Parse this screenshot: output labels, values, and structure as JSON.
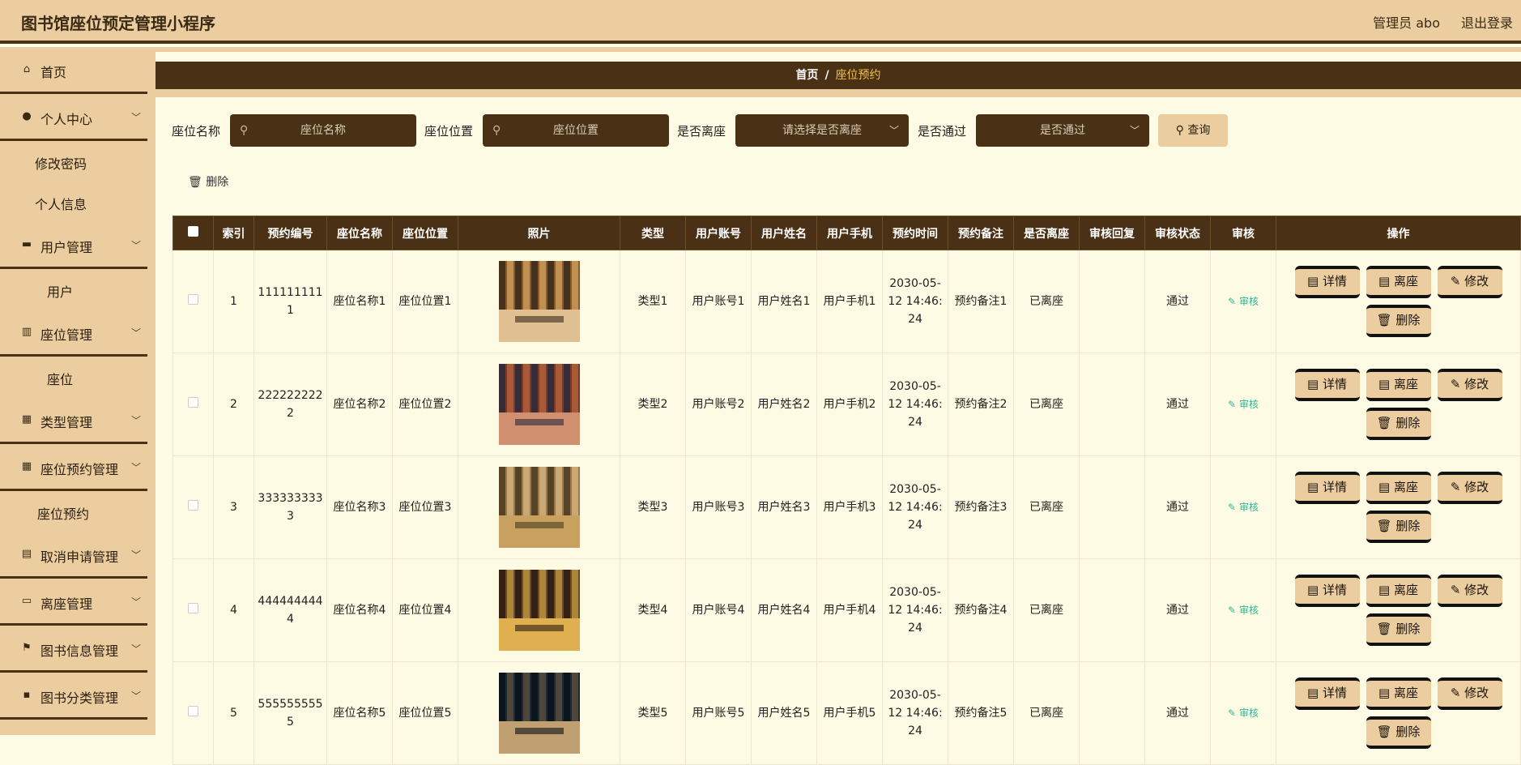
{
  "app": {
    "title": "图书馆座位预定管理小程序",
    "user": "管理员 abo",
    "logout": "退出登录"
  },
  "sidebar": {
    "items": [
      {
        "label": "首页",
        "icon": "home-icon",
        "glyph": "⌂",
        "chevron": false
      },
      {
        "label": "个人中心",
        "icon": "user-icon",
        "glyph": "●",
        "chevron": true
      },
      {
        "label": "修改密码",
        "sub": true,
        "indent": 43
      },
      {
        "label": "个人信息",
        "sub": true,
        "indent": 43
      },
      {
        "label": "用户管理",
        "icon": "briefcase-icon",
        "glyph": "▬",
        "chevron": true
      },
      {
        "label": "用户",
        "sub": true,
        "indent": 58
      },
      {
        "label": "座位管理",
        "icon": "library-icon",
        "glyph": "▥",
        "chevron": true
      },
      {
        "label": "座位",
        "sub": true,
        "indent": 58
      },
      {
        "label": "类型管理",
        "icon": "grid-icon",
        "glyph": "▦",
        "chevron": true
      },
      {
        "label": "座位预约管理",
        "icon": "grid-icon",
        "glyph": "▦",
        "chevron": true
      },
      {
        "label": "座位预约",
        "sub": true,
        "indent": 46
      },
      {
        "label": "取消申请管理",
        "icon": "clipboard-icon",
        "glyph": "▤",
        "chevron": true
      },
      {
        "label": "离座管理",
        "icon": "monitor-icon",
        "glyph": "▭",
        "chevron": true
      },
      {
        "label": "图书信息管理",
        "icon": "flag-icon",
        "glyph": "⚑",
        "chevron": true
      },
      {
        "label": "图书分类管理",
        "icon": "chat-icon",
        "glyph": "▪",
        "chevron": true
      }
    ]
  },
  "breadcrumb": {
    "home": "首页",
    "sep": "/",
    "current": "座位预约"
  },
  "search": {
    "seat_name_label": "座位名称",
    "seat_name_placeholder": "座位名称",
    "seat_pos_label": "座位位置",
    "seat_pos_placeholder": "座位位置",
    "left_label": "是否离座",
    "left_placeholder": "请选择是否离座",
    "pass_label": "是否通过",
    "pass_placeholder": "是否通过",
    "query_button": "查询"
  },
  "toolbar": {
    "delete_label": "删除"
  },
  "table": {
    "headers": [
      "索引",
      "预约编号",
      "座位名称",
      "座位位置",
      "照片",
      "类型",
      "用户账号",
      "用户姓名",
      "用户手机",
      "预约时间",
      "预约备注",
      "是否离座",
      "审核回复",
      "审核状态",
      "审核",
      "操作"
    ],
    "rows": [
      {
        "index": "1",
        "code": "1111111111",
        "seat_name": "座位名称1",
        "seat_pos": "座位位置1",
        "type": "类型1",
        "account": "用户账号1",
        "name": "用户姓名1",
        "phone": "用户手机1",
        "time": "2030-05-12 14:46:24",
        "note": "预约备注1",
        "left": "已离座",
        "reply": "",
        "status": "通过",
        "audit": "审核"
      },
      {
        "index": "2",
        "code": "2222222222",
        "seat_name": "座位名称2",
        "seat_pos": "座位位置2",
        "type": "类型2",
        "account": "用户账号2",
        "name": "用户姓名2",
        "phone": "用户手机2",
        "time": "2030-05-12 14:46:24",
        "note": "预约备注2",
        "left": "已离座",
        "reply": "",
        "status": "通过",
        "audit": "审核"
      },
      {
        "index": "3",
        "code": "3333333333",
        "seat_name": "座位名称3",
        "seat_pos": "座位位置3",
        "type": "类型3",
        "account": "用户账号3",
        "name": "用户姓名3",
        "phone": "用户手机3",
        "time": "2030-05-12 14:46:24",
        "note": "预约备注3",
        "left": "已离座",
        "reply": "",
        "status": "通过",
        "audit": "审核"
      },
      {
        "index": "4",
        "code": "4444444444",
        "seat_name": "座位名称4",
        "seat_pos": "座位位置4",
        "type": "类型4",
        "account": "用户账号4",
        "name": "用户姓名4",
        "phone": "用户手机4",
        "time": "2030-05-12 14:46:24",
        "note": "预约备注4",
        "left": "已离座",
        "reply": "",
        "status": "通过",
        "audit": "审核"
      },
      {
        "index": "5",
        "code": "5555555555",
        "seat_name": "座位名称5",
        "seat_pos": "座位位置5",
        "type": "类型5",
        "account": "用户账号5",
        "name": "用户姓名5",
        "phone": "用户手机5",
        "time": "2030-05-12 14:46:24",
        "note": "预约备注5",
        "left": "已离座",
        "reply": "",
        "status": "通过",
        "audit": "审核"
      }
    ],
    "actions": [
      "详情",
      "离座",
      "修改",
      "删除"
    ]
  },
  "colors": {
    "accent": "#4a3015",
    "beige": "#ebcda0",
    "bg": "#fdfbe3",
    "audit": "#2fb59a",
    "crumb": "#f5c242"
  }
}
